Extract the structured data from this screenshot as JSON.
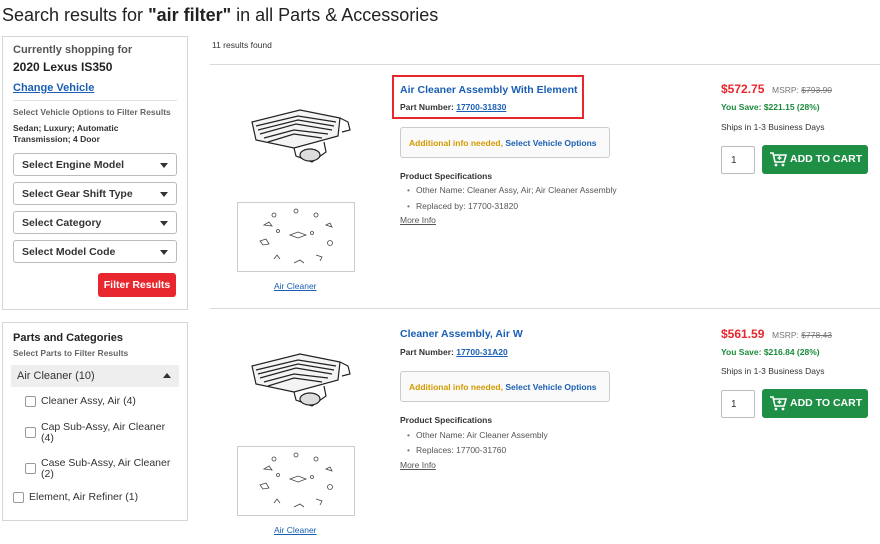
{
  "header": {
    "prefix": "Search results for ",
    "query": "\"air filter\"",
    "suffix": " in all Parts & Accessories"
  },
  "sidebar": {
    "shopping_label": "Currently shopping for",
    "vehicle": "2020 Lexus IS350",
    "change_vehicle": "Change Vehicle",
    "filter_hint": "Select Vehicle Options to Filter Results",
    "vehicle_options_line1": "Sedan; Luxury; Automatic",
    "vehicle_options_line2": "Transmission; 4 Door",
    "selects": [
      "Select Engine Model",
      "Select Gear Shift Type",
      "Select Category",
      "Select Model Code"
    ],
    "filter_button": "Filter Results"
  },
  "parts_panel": {
    "title": "Parts and Categories",
    "subtitle": "Select Parts to Filter Results",
    "category": "Air Cleaner (10)",
    "items": [
      {
        "line1": "Cleaner Assy, Air (4)",
        "line2": ""
      },
      {
        "line1": "Cap Sub-Assy, Air Cleaner",
        "line2": "(4)"
      },
      {
        "line1": "Case Sub-Assy, Air Cleaner",
        "line2": "(2)"
      }
    ],
    "extra_item": "Element, Air Refiner (1)"
  },
  "results_count": "11 results found",
  "products": [
    {
      "name": "Air Cleaner Assembly With Element",
      "part_label": "Part Number: ",
      "part_number": "17700-31830",
      "info_needed": "Additional info needed, ",
      "info_link": "Select Vehicle Options",
      "spec_title": "Product Specifications",
      "specs": [
        "Other Name: Cleaner Assy, Air; Air Cleaner Assembly",
        "Replaced by: 17700-31820"
      ],
      "more_info": "More Info",
      "image_caption": "Air Cleaner",
      "price": "$572.75",
      "msrp_label": "MSRP: ",
      "msrp": "$793.90",
      "you_save": "You Save: $221.15 (28%)",
      "shipping": "Ships in 1-3 Business Days",
      "quantity": "1",
      "cart_label": "ADD TO CART"
    },
    {
      "name": "Cleaner Assembly, Air W",
      "part_label": "Part Number: ",
      "part_number": "17700-31A20",
      "info_needed": "Additional info needed, ",
      "info_link": "Select Vehicle Options",
      "spec_title": "Product Specifications",
      "specs": [
        "Other Name: Air Cleaner Assembly",
        "Replaces: 17700-31760"
      ],
      "more_info": "More Info",
      "image_caption": "Air Cleaner",
      "price": "$561.59",
      "msrp_label": "MSRP: ",
      "msrp": "$778.43",
      "you_save": "You Save: $216.84 (28%)",
      "shipping": "Ships in 1-3 Business Days",
      "quantity": "1",
      "cart_label": "ADD TO CART"
    }
  ],
  "colors": {
    "link": "#1a5fb4",
    "price": "#e8262d",
    "save": "#1b8a3b",
    "cart": "#1f8f46",
    "info_needed": "#d39a00"
  }
}
